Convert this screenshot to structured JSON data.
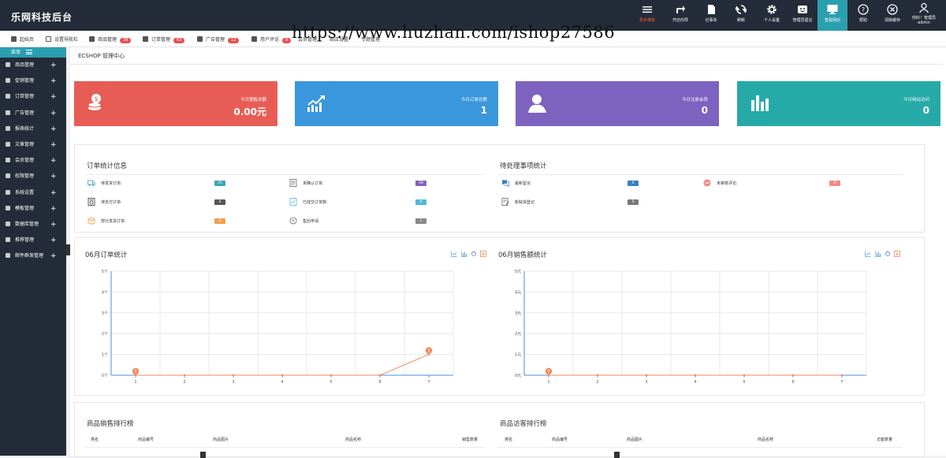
{
  "app": {
    "title": "乐网科技后台"
  },
  "top_toolbar": {
    "items": [
      {
        "label": "更多模板",
        "icon": "menu-icon",
        "color": "#ff5a3c"
      },
      {
        "label": "开店向导",
        "icon": "share-arrow-icon"
      },
      {
        "label": "记事本",
        "icon": "notepad-icon"
      },
      {
        "label": "刷新",
        "icon": "refresh-icon"
      },
      {
        "label": "个人设置",
        "icon": "gear-icon"
      },
      {
        "label": "管理员留言",
        "icon": "message-icon"
      },
      {
        "label": "查看网店",
        "icon": "monitor-icon",
        "active": true
      },
      {
        "label": "帮助",
        "icon": "help-icon"
      },
      {
        "label": "清除缓存",
        "icon": "close-circle-icon"
      }
    ],
    "user": {
      "greeting": "你好！管理员",
      "name": "admin"
    }
  },
  "subnav": {
    "items": [
      {
        "label": "起始页"
      },
      {
        "label": "设置导航栏"
      },
      {
        "label": "商品管理",
        "badge": "38"
      },
      {
        "label": "订单管理",
        "badge": "63"
      },
      {
        "label": "广告管理",
        "badge": "12"
      },
      {
        "label": "用户评论",
        "badge": "0"
      },
      {
        "label": "会员管理"
      },
      {
        "label": "商店设置"
      },
      {
        "label": "专题管理"
      }
    ]
  },
  "watermark": "https://www.huzhan.com/ishop27586",
  "sidebar": {
    "header": "菜单",
    "items": [
      {
        "label": "商品管理"
      },
      {
        "label": "促销管理"
      },
      {
        "label": "订单管理"
      },
      {
        "label": "广告管理"
      },
      {
        "label": "报表统计"
      },
      {
        "label": "文章管理"
      },
      {
        "label": "会员管理"
      },
      {
        "label": "权限管理"
      },
      {
        "label": "系统设置"
      },
      {
        "label": "模板管理"
      },
      {
        "label": "数据库管理"
      },
      {
        "label": "推荐管理"
      },
      {
        "label": "邮件群发管理"
      }
    ]
  },
  "main": {
    "heading": "ECSHOP 管理中心"
  },
  "stats": [
    {
      "label": "今日销售总额",
      "value": "0.00元",
      "color": "#e75d56",
      "icon": "coins-icon"
    },
    {
      "label": "今日订单总数",
      "value": "1",
      "color": "#3a97dc",
      "icon": "trend-up-icon"
    },
    {
      "label": "今日注册会员",
      "value": "0",
      "color": "#7d62c0",
      "icon": "user-icon"
    },
    {
      "label": "今日网站访问",
      "value": "0",
      "color": "#26aaa8",
      "icon": "bar-chart-icon"
    }
  ],
  "order_stats": {
    "title": "订单统计信息",
    "rows": [
      {
        "label": "待发货订单:",
        "value": "25",
        "color": "#3ea5b6"
      },
      {
        "label": "未确认订单:",
        "value": "58",
        "color": "#8563b8"
      },
      {
        "label": "待支付订单:",
        "value": "0",
        "color": "#555555"
      },
      {
        "label": "已成交订单数:",
        "value": "0",
        "color": "#4fb8d8"
      },
      {
        "label": "部分发货订单:",
        "value": "0",
        "color": "#f0a04b"
      },
      {
        "label": "售后申请:",
        "value": "1",
        "color": "#888888"
      }
    ]
  },
  "pending": {
    "title": "待处理事项统计",
    "rows": [
      {
        "label": "最新留言:",
        "value": "0",
        "color": "#3a7fc1"
      },
      {
        "label": "未审核评论:",
        "value": "0",
        "color": "#f28b82"
      },
      {
        "label": "新缺货登记",
        "value": "0",
        "color": "#777777"
      }
    ]
  },
  "chart_data": [
    {
      "type": "line",
      "title": "06月订单统计",
      "x": [
        1,
        2,
        3,
        4,
        5,
        6,
        7
      ],
      "series": [
        {
          "values": [
            0,
            0,
            0,
            0,
            0,
            0,
            1
          ]
        }
      ],
      "ylim": [
        0,
        5
      ],
      "yticks": [
        "0个",
        "1个",
        "2个",
        "3个",
        "4个",
        "5个"
      ],
      "grid": true,
      "color": "#f08a5d"
    },
    {
      "type": "line",
      "title": "06月销售额统计",
      "x": [
        1,
        2,
        3,
        4,
        5,
        6,
        7
      ],
      "series": [
        {
          "values": [
            0,
            0,
            0,
            0,
            0,
            0,
            0
          ]
        }
      ],
      "ylim": [
        0,
        5
      ],
      "yticks": [
        "0元",
        "1元",
        "2元",
        "3元",
        "4元",
        "5元"
      ],
      "grid": true,
      "color": "#f08a5d"
    }
  ],
  "rankings": [
    {
      "title": "商品销售排行榜",
      "columns": [
        "排名",
        "商品编号",
        "商品图片",
        "商品名称",
        "销售数量"
      ]
    },
    {
      "title": "商品访客排行榜",
      "columns": [
        "排名",
        "商品编号",
        "商品图片",
        "商品名称",
        "访客数量"
      ]
    }
  ]
}
